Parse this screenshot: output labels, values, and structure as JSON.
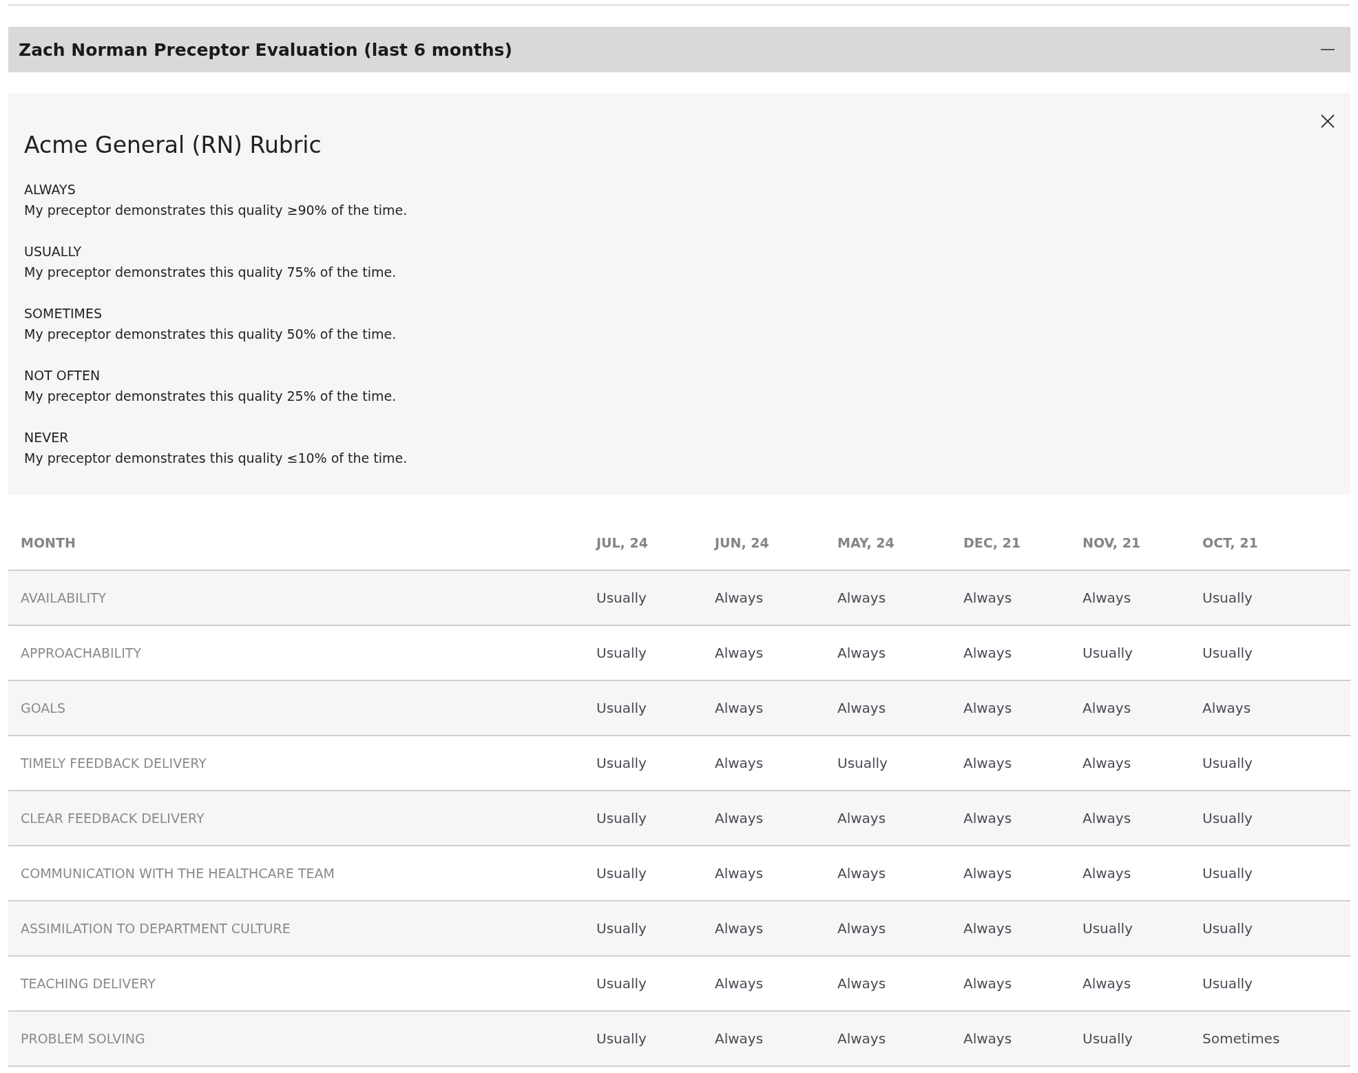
{
  "section": {
    "title": "Zach Norman Preceptor Evaluation (last 6 months)",
    "expanded": true
  },
  "rubric": {
    "title": "Acme General (RN) Rubric",
    "levels": [
      {
        "label": "ALWAYS",
        "description": "My preceptor demonstrates this quality ≥90% of the time."
      },
      {
        "label": "USUALLY",
        "description": "My preceptor demonstrates this quality 75% of the time."
      },
      {
        "label": "SOMETIMES",
        "description": "My preceptor demonstrates this quality 50% of the time."
      },
      {
        "label": "NOT OFTEN",
        "description": "My preceptor demonstrates this quality 25% of the time."
      },
      {
        "label": "NEVER",
        "description": "My preceptor demonstrates this quality ≤10% of the time."
      }
    ]
  },
  "table": {
    "columns": [
      "MONTH",
      "JUL, 24",
      "JUN, 24",
      "MAY, 24",
      "DEC, 21",
      "NOV, 21",
      "OCT, 21"
    ],
    "rows": [
      {
        "label": "AVAILABILITY",
        "values": [
          "Usually",
          "Always",
          "Always",
          "Always",
          "Always",
          "Usually"
        ]
      },
      {
        "label": "APPROACHABILITY",
        "values": [
          "Usually",
          "Always",
          "Always",
          "Always",
          "Usually",
          "Usually"
        ]
      },
      {
        "label": "GOALS",
        "values": [
          "Usually",
          "Always",
          "Always",
          "Always",
          "Always",
          "Always"
        ]
      },
      {
        "label": "TIMELY FEEDBACK DELIVERY",
        "values": [
          "Usually",
          "Always",
          "Usually",
          "Always",
          "Always",
          "Usually"
        ]
      },
      {
        "label": "CLEAR FEEDBACK DELIVERY",
        "values": [
          "Usually",
          "Always",
          "Always",
          "Always",
          "Always",
          "Usually"
        ]
      },
      {
        "label": "COMMUNICATION WITH THE HEALTHCARE TEAM",
        "values": [
          "Usually",
          "Always",
          "Always",
          "Always",
          "Always",
          "Usually"
        ]
      },
      {
        "label": "ASSIMILATION TO DEPARTMENT CULTURE",
        "values": [
          "Usually",
          "Always",
          "Always",
          "Always",
          "Usually",
          "Usually"
        ]
      },
      {
        "label": "TEACHING DELIVERY",
        "values": [
          "Usually",
          "Always",
          "Always",
          "Always",
          "Always",
          "Usually"
        ]
      },
      {
        "label": "PROBLEM SOLVING",
        "values": [
          "Usually",
          "Always",
          "Always",
          "Always",
          "Usually",
          "Sometimes"
        ]
      }
    ]
  }
}
